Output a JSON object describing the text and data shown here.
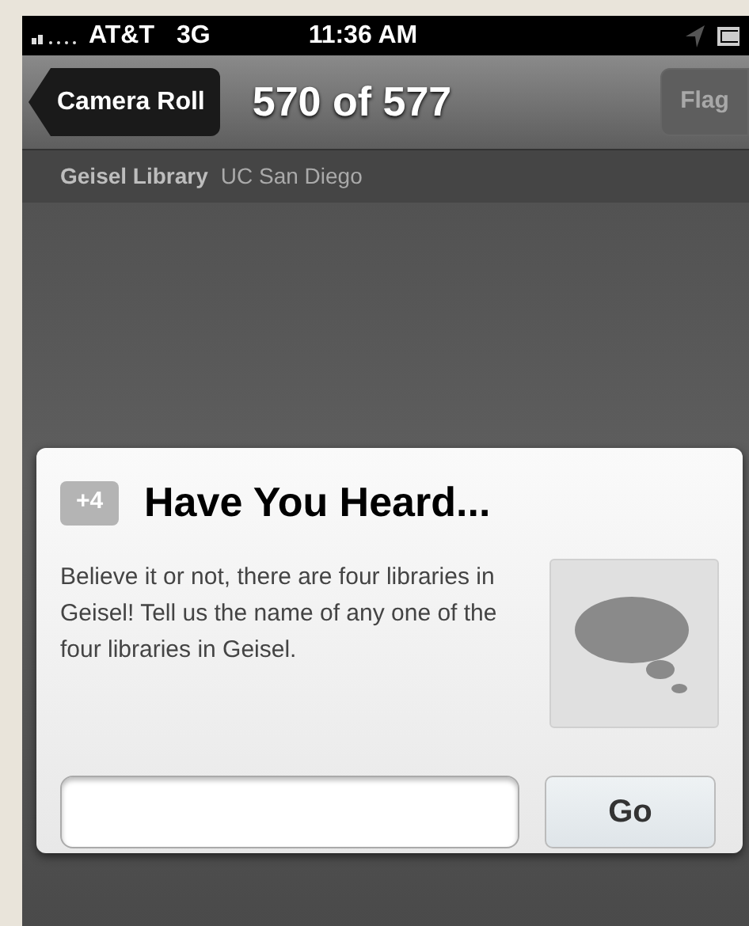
{
  "status_bar": {
    "carrier": "AT&T",
    "network": "3G",
    "time": "11:36 AM"
  },
  "nav_bar": {
    "back_button": "Camera Roll",
    "title": "570 of 577",
    "flag_button": {
      "label": "Flag",
      "disabled": true
    }
  },
  "location_bar": {
    "place": "Geisel Library",
    "area": "UC San Diego"
  },
  "card": {
    "badge": "+4",
    "title": "Have You Heard...",
    "body": "Believe it or not, there are four libraries in Geisel! Tell us the name of any one of the four libraries in Geisel.",
    "go_button": "Go"
  }
}
